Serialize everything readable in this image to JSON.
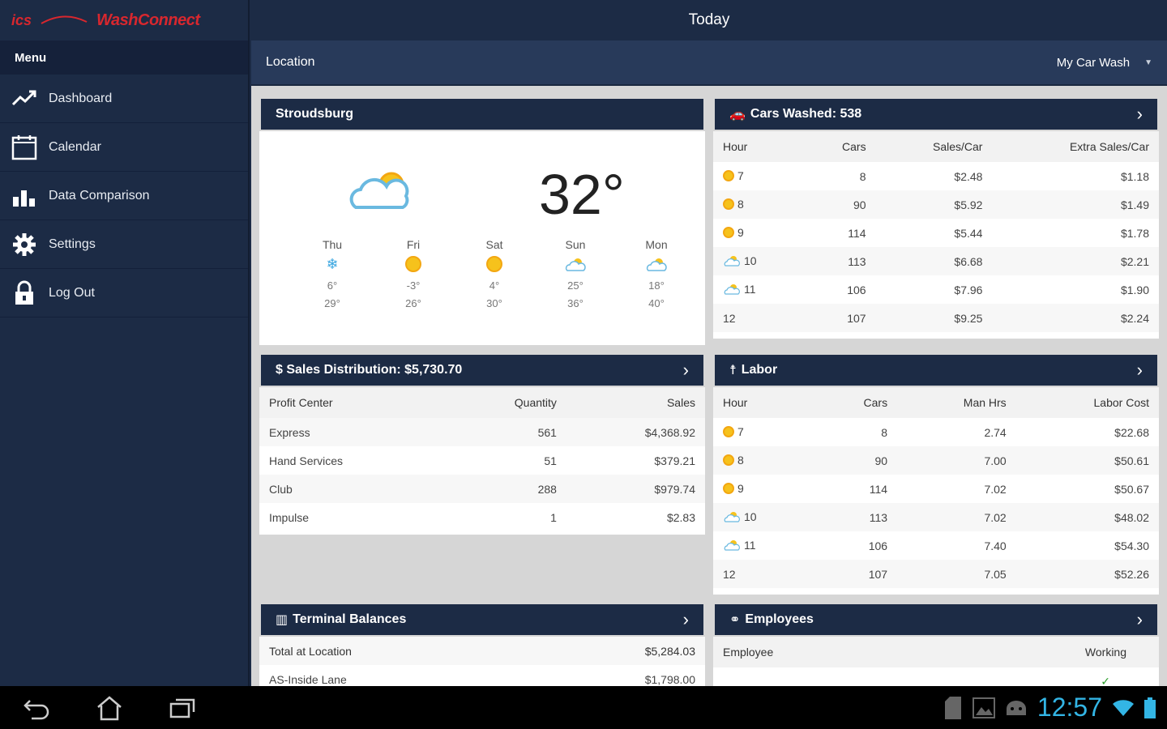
{
  "app": {
    "logo_left": "ics",
    "logo_right": "WashConnect"
  },
  "sidebar": {
    "menu_title": "Menu",
    "items": [
      {
        "label": "Dashboard",
        "icon": "trend-icon"
      },
      {
        "label": "Calendar",
        "icon": "calendar-icon"
      },
      {
        "label": "Data Comparison",
        "icon": "bar-chart-icon"
      },
      {
        "label": "Settings",
        "icon": "gear-icon"
      },
      {
        "label": "Log Out",
        "icon": "lock-icon"
      }
    ]
  },
  "header": {
    "title": "Today",
    "location_label": "Location",
    "location_value": "My Car Wash"
  },
  "weather": {
    "city": "Stroudsburg",
    "current_temp": "32°",
    "forecast": [
      {
        "day": "Thu",
        "icon": "snow-icon",
        "low": "6°",
        "high": "29°"
      },
      {
        "day": "Fri",
        "icon": "sun-icon",
        "low": "-3°",
        "high": "26°"
      },
      {
        "day": "Sat",
        "icon": "sun-icon",
        "low": "4°",
        "high": "30°"
      },
      {
        "day": "Sun",
        "icon": "partly-cloudy-icon",
        "low": "25°",
        "high": "36°"
      },
      {
        "day": "Mon",
        "icon": "partly-cloudy-icon",
        "low": "18°",
        "high": "40°"
      }
    ]
  },
  "cars_washed": {
    "title": "Cars Washed: 538",
    "headers": [
      "Hour",
      "Cars",
      "Sales/Car",
      "Extra Sales/Car"
    ],
    "rows": [
      {
        "icon": "sun",
        "hour": "7",
        "cars": "8",
        "sales": "$2.48",
        "extra": "$1.18"
      },
      {
        "icon": "sun",
        "hour": "8",
        "cars": "90",
        "sales": "$5.92",
        "extra": "$1.49"
      },
      {
        "icon": "sun",
        "hour": "9",
        "cars": "114",
        "sales": "$5.44",
        "extra": "$1.78"
      },
      {
        "icon": "cloud",
        "hour": "10",
        "cars": "113",
        "sales": "$6.68",
        "extra": "$2.21"
      },
      {
        "icon": "cloud",
        "hour": "11",
        "cars": "106",
        "sales": "$7.96",
        "extra": "$1.90"
      },
      {
        "icon": "",
        "hour": "12",
        "cars": "107",
        "sales": "$9.25",
        "extra": "$2.24"
      }
    ]
  },
  "sales_distribution": {
    "title": "$ Sales Distribution: $5,730.70",
    "headers": [
      "Profit Center",
      "Quantity",
      "Sales"
    ],
    "rows": [
      {
        "center": "Express",
        "qty": "561",
        "sales": "$4,368.92"
      },
      {
        "center": "Hand Services",
        "qty": "51",
        "sales": "$379.21"
      },
      {
        "center": "Club",
        "qty": "288",
        "sales": "$979.74"
      },
      {
        "center": "Impulse",
        "qty": "1",
        "sales": "$2.83"
      }
    ]
  },
  "labor": {
    "title": "Labor",
    "headers": [
      "Hour",
      "Cars",
      "Man Hrs",
      "Labor Cost"
    ],
    "rows": [
      {
        "icon": "sun",
        "hour": "7",
        "cars": "8",
        "hrs": "2.74",
        "cost": "$22.68"
      },
      {
        "icon": "sun",
        "hour": "8",
        "cars": "90",
        "hrs": "7.00",
        "cost": "$50.61"
      },
      {
        "icon": "sun",
        "hour": "9",
        "cars": "114",
        "hrs": "7.02",
        "cost": "$50.67"
      },
      {
        "icon": "cloud",
        "hour": "10",
        "cars": "113",
        "hrs": "7.02",
        "cost": "$48.02"
      },
      {
        "icon": "cloud",
        "hour": "11",
        "cars": "106",
        "hrs": "7.40",
        "cost": "$54.30"
      },
      {
        "icon": "",
        "hour": "12",
        "cars": "107",
        "hrs": "7.05",
        "cost": "$52.26"
      }
    ]
  },
  "terminal_balances": {
    "title": "Terminal Balances",
    "rows": [
      {
        "label": "Total at Location",
        "value": "$5,284.03"
      },
      {
        "label": "AS-Inside Lane",
        "value": "$1,798.00"
      }
    ]
  },
  "employees": {
    "title": "Employees",
    "headers": [
      "Employee",
      "Working"
    ],
    "first_row_check": "✓"
  },
  "system": {
    "clock": "12:57"
  },
  "colors": {
    "navy": "#1c2b45",
    "brand_red": "#d8272e",
    "clock_blue": "#33b5e5"
  }
}
